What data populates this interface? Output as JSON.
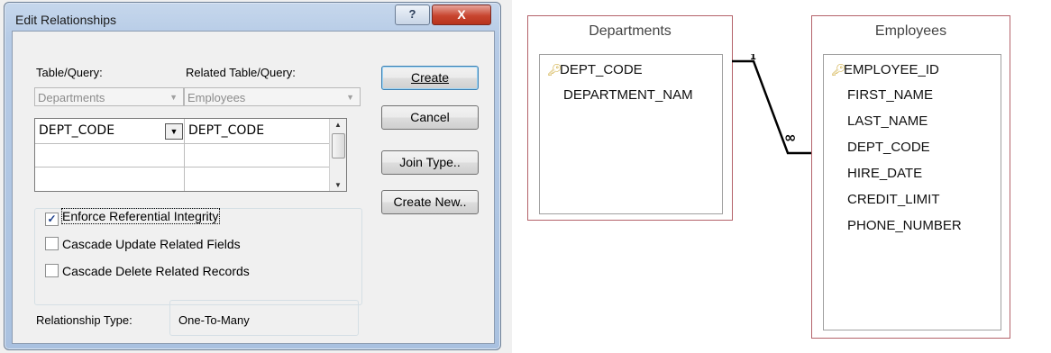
{
  "dialog": {
    "title": "Edit Relationships",
    "help_glyph": "?",
    "close_glyph": "X",
    "table_query_label": "Table/Query:",
    "related_table_query_label": "Related Table/Query:",
    "table_value": "Departments",
    "related_table_value": "Employees",
    "grid_rows": [
      {
        "left": "DEPT_CODE",
        "right": "DEPT_CODE"
      },
      {
        "left": "",
        "right": ""
      },
      {
        "left": "",
        "right": ""
      }
    ],
    "buttons": {
      "create": "Create",
      "cancel": "Cancel",
      "join_type": "Join Type..",
      "create_new": "Create New.."
    },
    "options": {
      "enforce": {
        "label": "Enforce Referential Integrity",
        "checked": true
      },
      "cascade_update": {
        "label": "Cascade Update Related Fields",
        "checked": false
      },
      "cascade_delete": {
        "label": "Cascade Delete Related Records",
        "checked": false
      }
    },
    "relationship_type_label": "Relationship Type:",
    "relationship_type_value": "One-To-Many"
  },
  "diagram": {
    "departments": {
      "title": "Departments",
      "fields": [
        {
          "name": "DEPT_CODE",
          "key": true
        },
        {
          "name": "DEPARTMENT_NAM",
          "key": false
        }
      ]
    },
    "employees": {
      "title": "Employees",
      "fields": [
        {
          "name": "EMPLOYEE_ID",
          "key": true
        },
        {
          "name": "FIRST_NAME",
          "key": false
        },
        {
          "name": "LAST_NAME",
          "key": false
        },
        {
          "name": "DEPT_CODE",
          "key": false
        },
        {
          "name": "HIRE_DATE",
          "key": false
        },
        {
          "name": "CREDIT_LIMIT",
          "key": false
        },
        {
          "name": "PHONE_NUMBER",
          "key": false
        }
      ]
    },
    "relationship": {
      "one_label": "1",
      "many_label": "∞"
    }
  },
  "colors": {
    "table_border": "#b4636a",
    "dialog_frame": "#b6cbe6",
    "close_button": "#c8452f",
    "key_icon": "#c9a227"
  }
}
